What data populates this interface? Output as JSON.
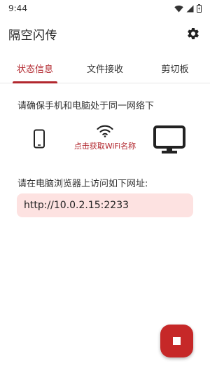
{
  "status_bar": {
    "time": "9:44"
  },
  "app": {
    "title": "隔空闪传"
  },
  "tabs": [
    {
      "label": "状态信息",
      "active": true
    },
    {
      "label": "文件接收",
      "active": false
    },
    {
      "label": "剪切板",
      "active": false
    }
  ],
  "main": {
    "instruction": "请确保手机和电脑处于同一网络下",
    "wifi_label": "点击获取WiFi名称",
    "url_instruction": "请在电脑浏览器上访问如下网址:",
    "url": "http://10.0.2.15:2233"
  },
  "colors": {
    "accent": "#b2272e",
    "url_bg": "#fde2e1",
    "fab": "#c62828"
  },
  "icons": [
    "wifi-icon",
    "signal-icon",
    "battery-icon",
    "gear-icon",
    "phone-icon",
    "monitor-icon",
    "stop-icon"
  ]
}
